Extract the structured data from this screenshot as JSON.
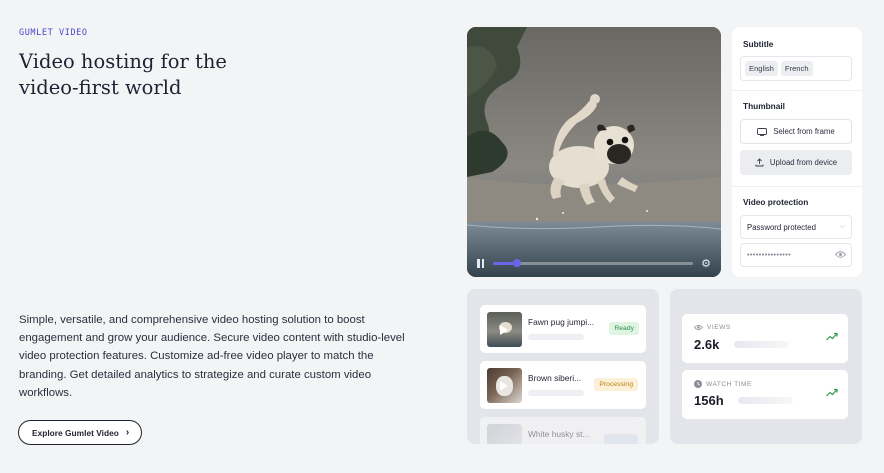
{
  "hero": {
    "eyebrow": "GUMLET VIDEO",
    "headline": "Video hosting for the video-first world",
    "description": "Simple, versatile, and comprehensive video hosting solution to boost engagement and grow your audience. Secure video content with studio-level video protection features. Customize ad-free video player to match the branding. Get detailed analytics to strategize and curate custom video workflows.",
    "cta_label": "Explore Gumlet Video",
    "cta_icon": "chevron-right-icon"
  },
  "player": {
    "progress": 0.12,
    "accent": "#6b63e8",
    "icons": [
      "pause-icon",
      "settings-icon"
    ]
  },
  "settings": {
    "subtitle_title": "Subtitle",
    "subtitle_chips": [
      "English",
      "French"
    ],
    "thumbnail_title": "Thumbnail",
    "select_frame_label": "Select from frame",
    "upload_label": "Upload from device",
    "protection_title": "Video protection",
    "protection_value": "Password protected",
    "password_mask": "•••••••••••••••"
  },
  "videos": [
    {
      "title": "Fawn pug jumpi...",
      "status": "Ready",
      "status_color": "#2f8c47"
    },
    {
      "title": "Brown siberi...",
      "status": "Processing",
      "status_color": "#b78318"
    },
    {
      "title": "White husky st...",
      "status": ""
    }
  ],
  "stats": {
    "views_label": "VIEWS",
    "views_value": "2.6k",
    "watch_label": "WATCH TIME",
    "watch_value": "156h",
    "trend_color": "#2f9a52"
  }
}
